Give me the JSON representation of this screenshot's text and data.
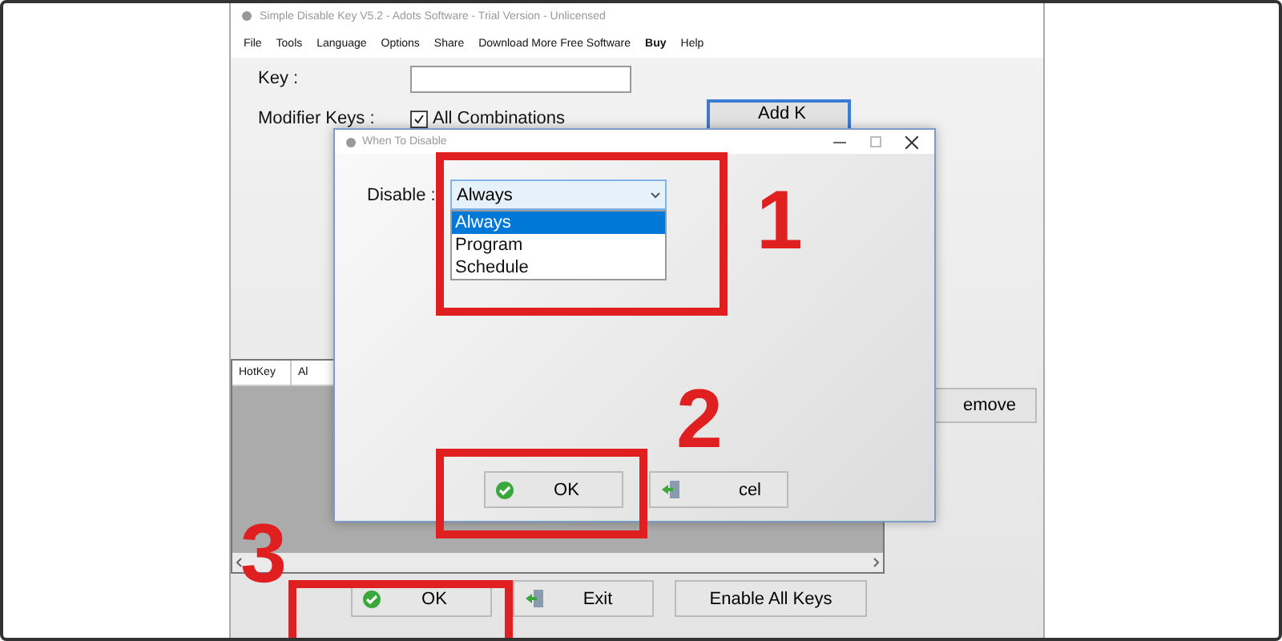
{
  "window": {
    "title": "Simple Disable Key V5.2 - Adots Software - Trial Version - Unlicensed"
  },
  "menu": [
    {
      "label": "File",
      "emphasized": false
    },
    {
      "label": "Tools",
      "emphasized": false
    },
    {
      "label": "Language",
      "emphasized": false
    },
    {
      "label": "Options",
      "emphasized": false
    },
    {
      "label": "Share",
      "emphasized": false
    },
    {
      "label": "Download More Free Software",
      "emphasized": false
    },
    {
      "label": "Buy",
      "emphasized": true
    },
    {
      "label": "Help",
      "emphasized": false
    }
  ],
  "key": {
    "label": "Key :"
  },
  "modifier": {
    "label": "Modifier Keys :",
    "checkbox": {
      "label": "All Combinations",
      "checked": true
    }
  },
  "add_button": {
    "label": "Add K"
  },
  "table": {
    "columns": [
      "HotKey",
      "Al"
    ]
  },
  "remove_button": {
    "label": "emove"
  },
  "buttons": [
    {
      "kind": "ok",
      "label": "OK"
    },
    {
      "kind": "exit",
      "label": "Exit"
    },
    {
      "kind": "plain",
      "label": "Enable All Keys"
    }
  ],
  "dialog": {
    "title": "When To Disable",
    "field_label": "Disable :",
    "value": "Always",
    "options": [
      {
        "label": "Always",
        "selected": true
      },
      {
        "label": "Program",
        "selected": false
      },
      {
        "label": "Schedule",
        "selected": false
      }
    ],
    "buttons": [
      {
        "kind": "ok",
        "label": "OK"
      },
      {
        "kind": "exit",
        "label": "cel"
      }
    ]
  },
  "annotations": [
    {
      "label": "1"
    },
    {
      "label": "2"
    },
    {
      "label": "3"
    }
  ]
}
